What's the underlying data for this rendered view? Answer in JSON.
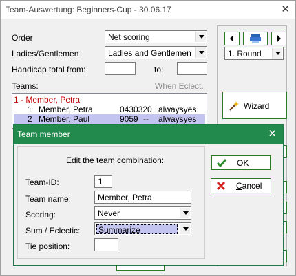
{
  "window": {
    "title": "Team-Auswertung: Beginners-Cup - 30.06.17"
  },
  "form": {
    "order_label": "Order",
    "order_value": "Net scoring",
    "ladies_label": "Ladies/Gentlemen",
    "ladies_value": "Ladies and Gentlemen",
    "handicap_label": "Handicap total from:",
    "handicap_from": "",
    "to_label": "to:",
    "handicap_to": "",
    "teams_label": "Teams:",
    "when_eclect": "When Eclect."
  },
  "teams_list": {
    "header": "1 - Member, Petra",
    "rows": [
      {
        "num": "1",
        "name": "Member, Petra",
        "hcp": "0430320",
        "flag": "alwaysyes"
      },
      {
        "num": "2",
        "name": "Member, Paul",
        "hcp": "9059",
        "dash": "--",
        "flag": "alwaysyes"
      }
    ]
  },
  "side_panel": {
    "round_value": "1. Round",
    "wizard_label": "Wizard"
  },
  "dialog": {
    "title": "Team member",
    "heading": "Edit the team combination:",
    "team_id_label": "Team-ID:",
    "team_id_value": "1",
    "team_name_label": "Team name:",
    "team_name_value": "Member, Petra",
    "scoring_label": "Scoring:",
    "scoring_value": "Never",
    "sum_label": "Sum / Eclectic:",
    "sum_value": "Summarize",
    "tie_label": "Tie position:",
    "tie_value": "",
    "ok_accel": "O",
    "ok_rest": "K",
    "cancel_accel": "C",
    "cancel_rest": "ancel"
  },
  "colors": {
    "accent_green": "#238a4e",
    "selection": "#c4c4f0",
    "team_header_red": "#c00000"
  }
}
